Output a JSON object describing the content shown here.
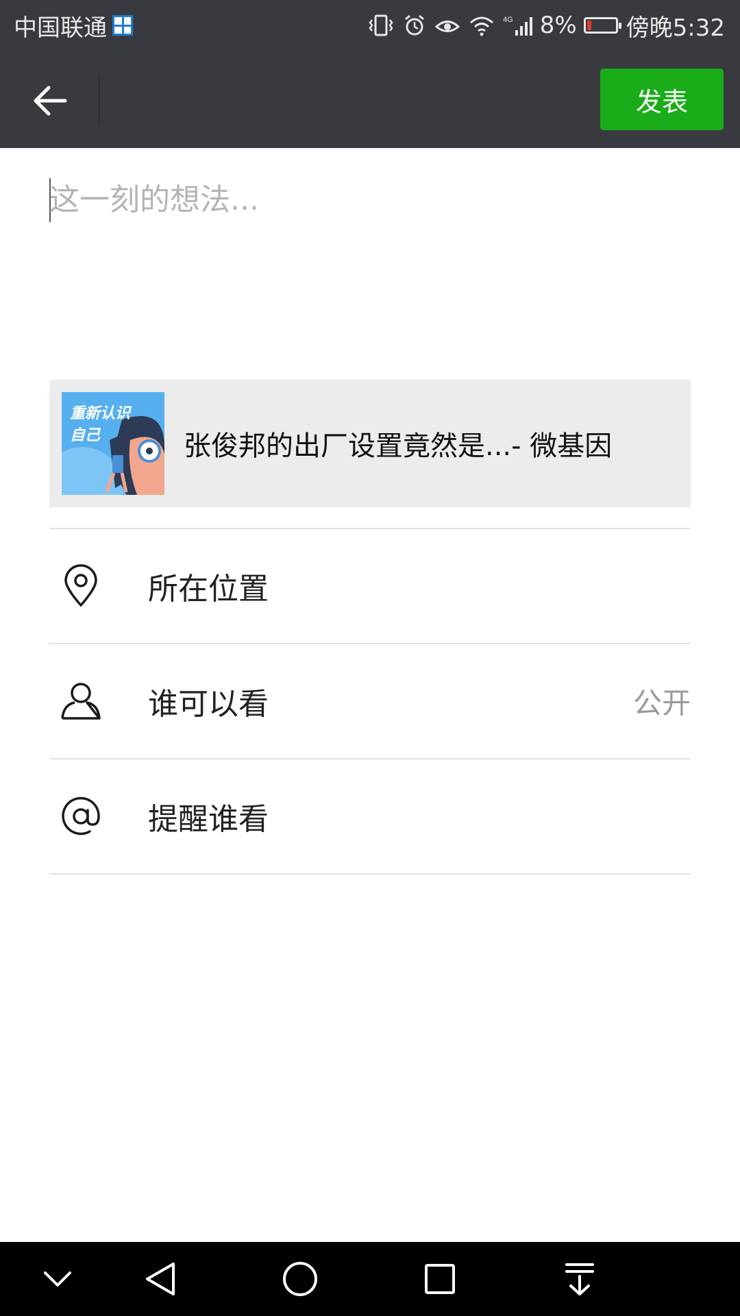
{
  "status_bar": {
    "carrier": "中国联通",
    "battery_percent": "8%",
    "time": "傍晚5:32",
    "network": "4G",
    "icons": [
      "windows-icon",
      "vibrate-icon",
      "alarm-icon",
      "eye-icon",
      "wifi-icon",
      "signal-icon",
      "battery-icon"
    ],
    "battery_level": 0.08
  },
  "app_bar": {
    "back_icon": "arrow-left-icon",
    "publish_label": "发表"
  },
  "compose": {
    "placeholder": "这一刻的想法...",
    "value": ""
  },
  "share_card": {
    "thumbnail_text": [
      "重新认识",
      "自己"
    ],
    "title": "张俊邦的出厂设置竟然是...- 微基因"
  },
  "options": [
    {
      "icon": "location-pin-icon",
      "label": "所在位置",
      "value": ""
    },
    {
      "icon": "person-icon",
      "label": "谁可以看",
      "value": "公开"
    },
    {
      "icon": "at-icon",
      "label": "提醒谁看",
      "value": ""
    }
  ],
  "nav_bar": {
    "icons": [
      "chevron-down-icon",
      "back-triangle-icon",
      "home-circle-icon",
      "recents-square-icon",
      "notification-pull-icon"
    ]
  },
  "colors": {
    "header_bg": "#393a3f",
    "publish_green": "#1aad19",
    "card_bg": "#ececec",
    "placeholder": "#b4b4b4"
  }
}
